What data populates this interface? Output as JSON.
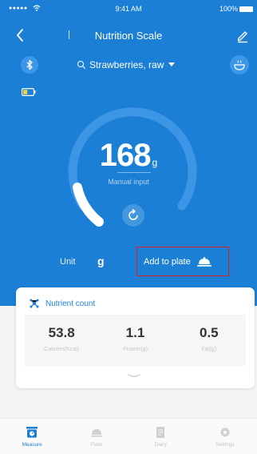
{
  "status_bar": {
    "time": "9:41 AM",
    "battery": "100%",
    "signal": "●●●●●"
  },
  "nav": {
    "title": "Nutrition Scale"
  },
  "food_selector": {
    "name": "Strawberries, raw"
  },
  "scale": {
    "weight": "168",
    "unit": "g",
    "mode_label": "Manual input"
  },
  "unit_row": {
    "label": "Unit",
    "value": "g",
    "add_to_plate": "Add to plate"
  },
  "nutrient_card": {
    "title": "Nutrient count",
    "items": [
      {
        "value": "53.8",
        "label": "Calories(Kcal)"
      },
      {
        "value": "1.1",
        "label": "Protein(g)"
      },
      {
        "value": "0.5",
        "label": "Fat(g)"
      }
    ]
  },
  "tabs": [
    {
      "label": "Measure",
      "icon": "scale-icon",
      "active": true
    },
    {
      "label": "Plate",
      "icon": "plate-icon",
      "active": false
    },
    {
      "label": "Diary",
      "icon": "diary-icon",
      "active": false
    },
    {
      "label": "Settings",
      "icon": "gear-icon",
      "active": false
    }
  ],
  "colors": {
    "primary": "#1b7fd6",
    "highlight_border": "#e02020",
    "card_bg": "#ffffff"
  }
}
